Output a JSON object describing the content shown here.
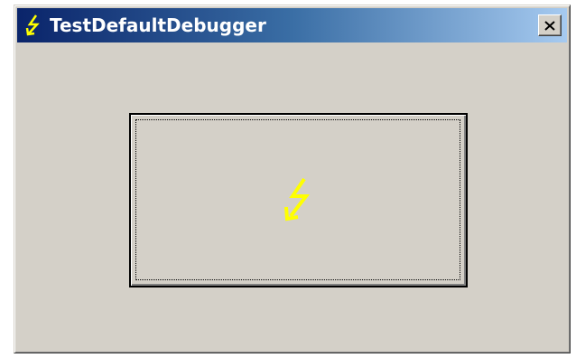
{
  "window": {
    "title": "TestDefaultDebugger",
    "title_icon": "lightning-bolt-icon",
    "close_icon": "close-icon",
    "colors": {
      "titlebar_start": "#0a246a",
      "titlebar_end": "#a6caf0",
      "face": "#d4d0c8",
      "bolt": "#ffff00"
    }
  },
  "main_button": {
    "icon": "lightning-bolt-icon",
    "label": ""
  }
}
